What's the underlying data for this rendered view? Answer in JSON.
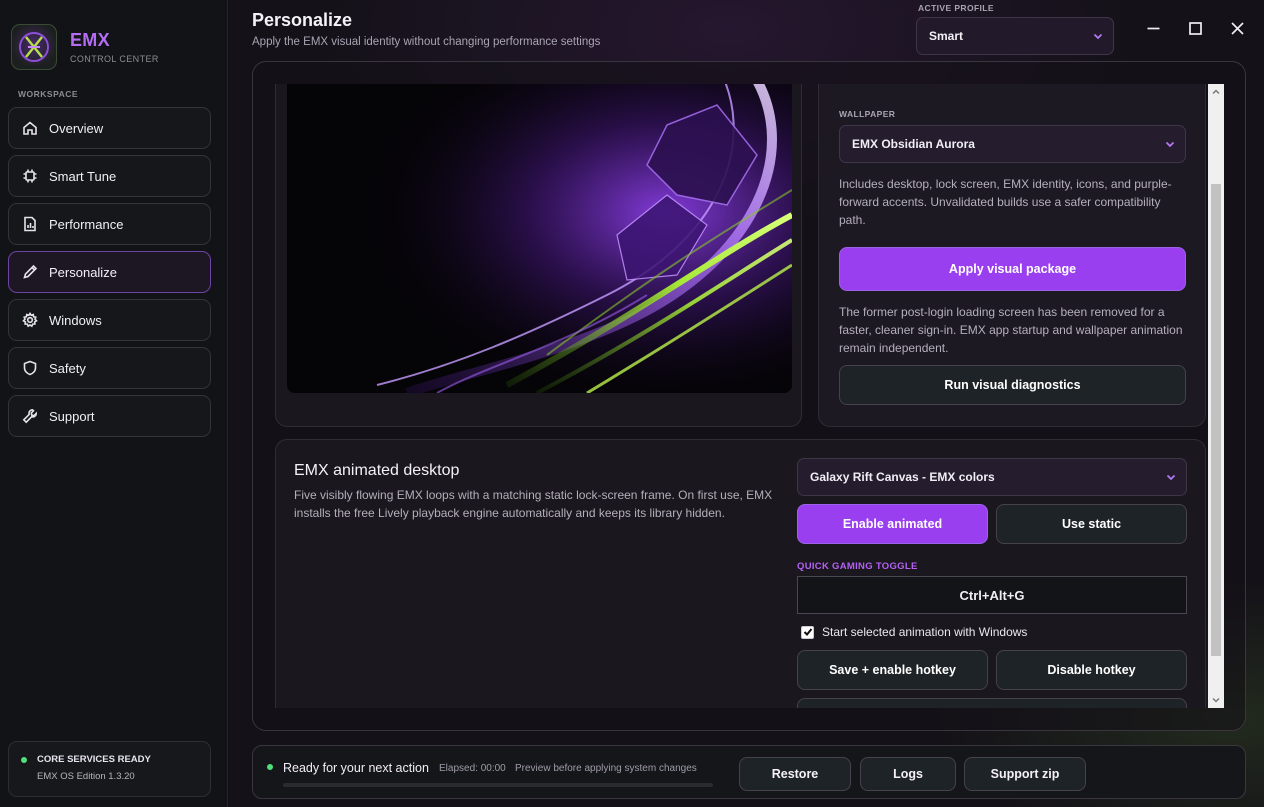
{
  "sidebar": {
    "brand_name": "EMX",
    "brand_sub": "CONTROL CENTER",
    "section_label": "WORKSPACE",
    "items": [
      {
        "label": "Overview",
        "icon": "home-icon"
      },
      {
        "label": "Smart Tune",
        "icon": "chip-icon"
      },
      {
        "label": "Performance",
        "icon": "chart-doc-icon"
      },
      {
        "label": "Personalize",
        "icon": "pen-icon",
        "active": true
      },
      {
        "label": "Windows",
        "icon": "gear-icon"
      },
      {
        "label": "Safety",
        "icon": "shield-icon"
      },
      {
        "label": "Support",
        "icon": "wrench-icon"
      }
    ],
    "status": {
      "title": "CORE SERVICES READY",
      "subtitle": "EMX OS Edition 1.3.20",
      "color": "#4fe07a"
    }
  },
  "header": {
    "title": "Personalize",
    "subtitle": "Apply the EMX visual identity without changing performance settings",
    "profile_label": "ACTIVE PROFILE",
    "profile_value": "Smart"
  },
  "window_controls": [
    "minimize-icon",
    "maximize-icon",
    "close-icon"
  ],
  "visual_package": {
    "wallpaper_label": "WALLPAPER",
    "wallpaper_value": "EMX Obsidian Aurora",
    "description": "Includes desktop, lock screen, EMX identity, icons, and purple-forward accents. Unvalidated builds use a safer compatibility path.",
    "apply_button": "Apply visual package",
    "note": "The former post-login loading screen has been removed for a faster, cleaner sign-in. EMX app startup and wallpaper animation remain independent.",
    "diagnostics_button": "Run visual diagnostics"
  },
  "animated_desktop": {
    "title": "EMX animated desktop",
    "description": "Five visibly flowing EMX loops with a matching static lock-screen frame. On first use, EMX installs the free Lively playback engine automatically and keeps its library hidden.",
    "selection": "Galaxy Rift Canvas - EMX colors",
    "enable_button": "Enable animated",
    "static_button": "Use static",
    "hotkey_label": "QUICK GAMING TOGGLE",
    "hotkey_value": "Ctrl+Alt+G",
    "startup_checkbox": "Start selected animation with Windows",
    "startup_checked": true,
    "save_hotkey_button": "Save + enable hotkey",
    "disable_hotkey_button": "Disable hotkey"
  },
  "footer": {
    "status": "Ready for your next action",
    "elapsed": "Elapsed: 00:00",
    "hint": "Preview before applying system changes",
    "progress": 0,
    "buttons": [
      "Restore",
      "Logs",
      "Support zip"
    ]
  },
  "colors": {
    "accent": "#9a3ff0",
    "accent_text": "#b461f5",
    "status_green": "#4fe07a",
    "lime": "#9fe03a"
  }
}
